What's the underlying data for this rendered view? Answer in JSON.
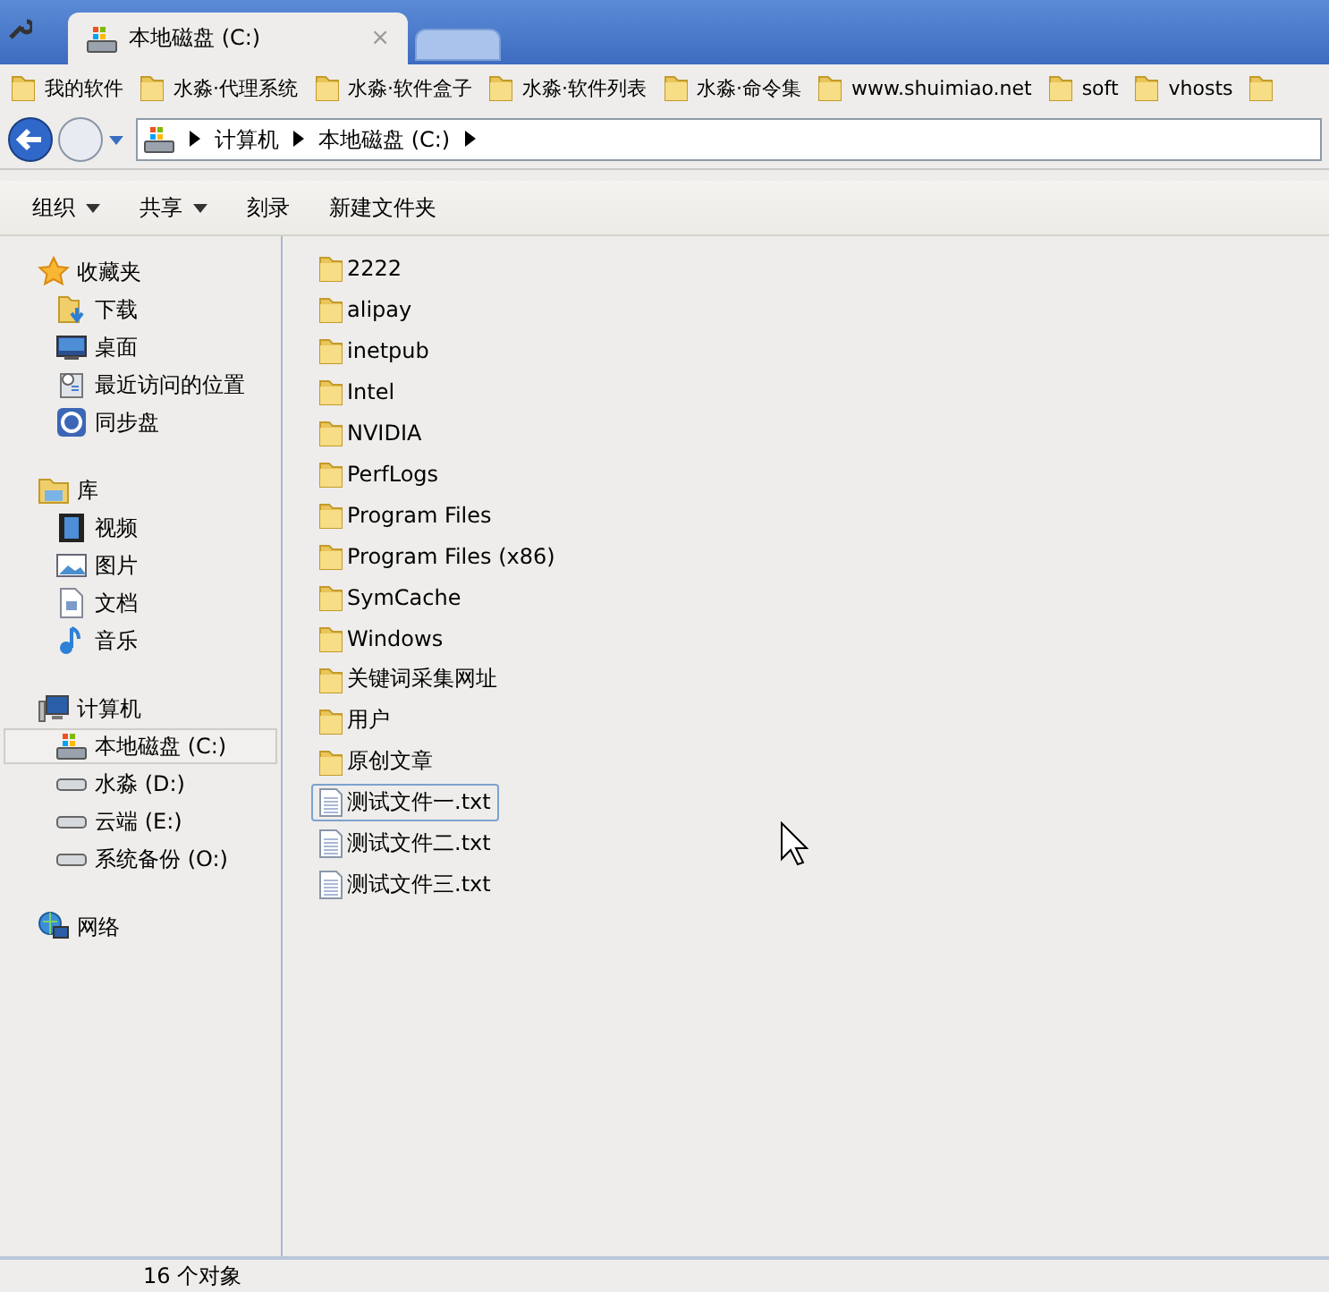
{
  "browser_tabs": [
    {
      "title": "本地磁盘 (C:)",
      "close": "×",
      "selected": true
    },
    {
      "selected": false
    }
  ],
  "bookmarks": [
    {
      "label": "我的软件"
    },
    {
      "label": "水淼·代理系统"
    },
    {
      "label": "水淼·软件盒子"
    },
    {
      "label": "水淼·软件列表"
    },
    {
      "label": "水淼·命令集"
    },
    {
      "label": "www.shuimiao.net"
    },
    {
      "label": "soft"
    },
    {
      "label": "vhosts"
    }
  ],
  "address_bar": {
    "path": [
      "计算机",
      "本地磁盘 (C:)"
    ]
  },
  "toolbar": [
    {
      "label": "组织",
      "dropdown": true
    },
    {
      "label": "共享",
      "dropdown": true
    },
    {
      "label": "刻录",
      "dropdown": false
    },
    {
      "label": "新建文件夹",
      "dropdown": false
    }
  ],
  "sidebar": [
    {
      "label": "收藏夹",
      "kind": "star",
      "selected": false,
      "children": [
        {
          "label": "下载",
          "kind": "download",
          "selected": false
        },
        {
          "label": "桌面",
          "kind": "desktop",
          "selected": false
        },
        {
          "label": "最近访问的位置",
          "kind": "recent",
          "selected": false
        },
        {
          "label": "同步盘",
          "kind": "sync",
          "selected": false
        }
      ]
    },
    {
      "label": "库",
      "kind": "library",
      "selected": false,
      "children": [
        {
          "label": "视频",
          "kind": "video",
          "selected": false
        },
        {
          "label": "图片",
          "kind": "picture",
          "selected": false
        },
        {
          "label": "文档",
          "kind": "document",
          "selected": false
        },
        {
          "label": "音乐",
          "kind": "music",
          "selected": false
        }
      ]
    },
    {
      "label": "计算机",
      "kind": "computer",
      "selected": false,
      "children": [
        {
          "label": "本地磁盘 (C:)",
          "kind": "system-drive",
          "selected": true
        },
        {
          "label": "水淼 (D:)",
          "kind": "drive",
          "selected": false
        },
        {
          "label": "云端 (E:)",
          "kind": "drive",
          "selected": false
        },
        {
          "label": "系统备份 (O:)",
          "kind": "drive",
          "selected": false
        }
      ]
    },
    {
      "label": "网络",
      "kind": "network",
      "selected": false
    }
  ],
  "files": [
    {
      "name": "2222",
      "kind": "folder",
      "selected": false
    },
    {
      "name": "alipay",
      "kind": "folder",
      "selected": false
    },
    {
      "name": "inetpub",
      "kind": "folder",
      "selected": false
    },
    {
      "name": "Intel",
      "kind": "folder",
      "selected": false
    },
    {
      "name": "NVIDIA",
      "kind": "folder",
      "selected": false
    },
    {
      "name": "PerfLogs",
      "kind": "folder",
      "selected": false
    },
    {
      "name": "Program Files",
      "kind": "folder",
      "selected": false
    },
    {
      "name": "Program Files (x86)",
      "kind": "folder",
      "selected": false
    },
    {
      "name": "SymCache",
      "kind": "folder",
      "selected": false
    },
    {
      "name": "Windows",
      "kind": "folder",
      "selected": false
    },
    {
      "name": "关键词采集网址",
      "kind": "folder",
      "selected": false
    },
    {
      "name": "用户",
      "kind": "folder",
      "selected": false
    },
    {
      "name": "原创文章",
      "kind": "folder",
      "selected": false
    },
    {
      "name": "测试文件一.txt",
      "kind": "text",
      "selected": true
    },
    {
      "name": "测试文件二.txt",
      "kind": "text",
      "selected": false
    },
    {
      "name": "测试文件三.txt",
      "kind": "text",
      "selected": false
    }
  ],
  "status_bar": {
    "count": "16 个对象"
  }
}
